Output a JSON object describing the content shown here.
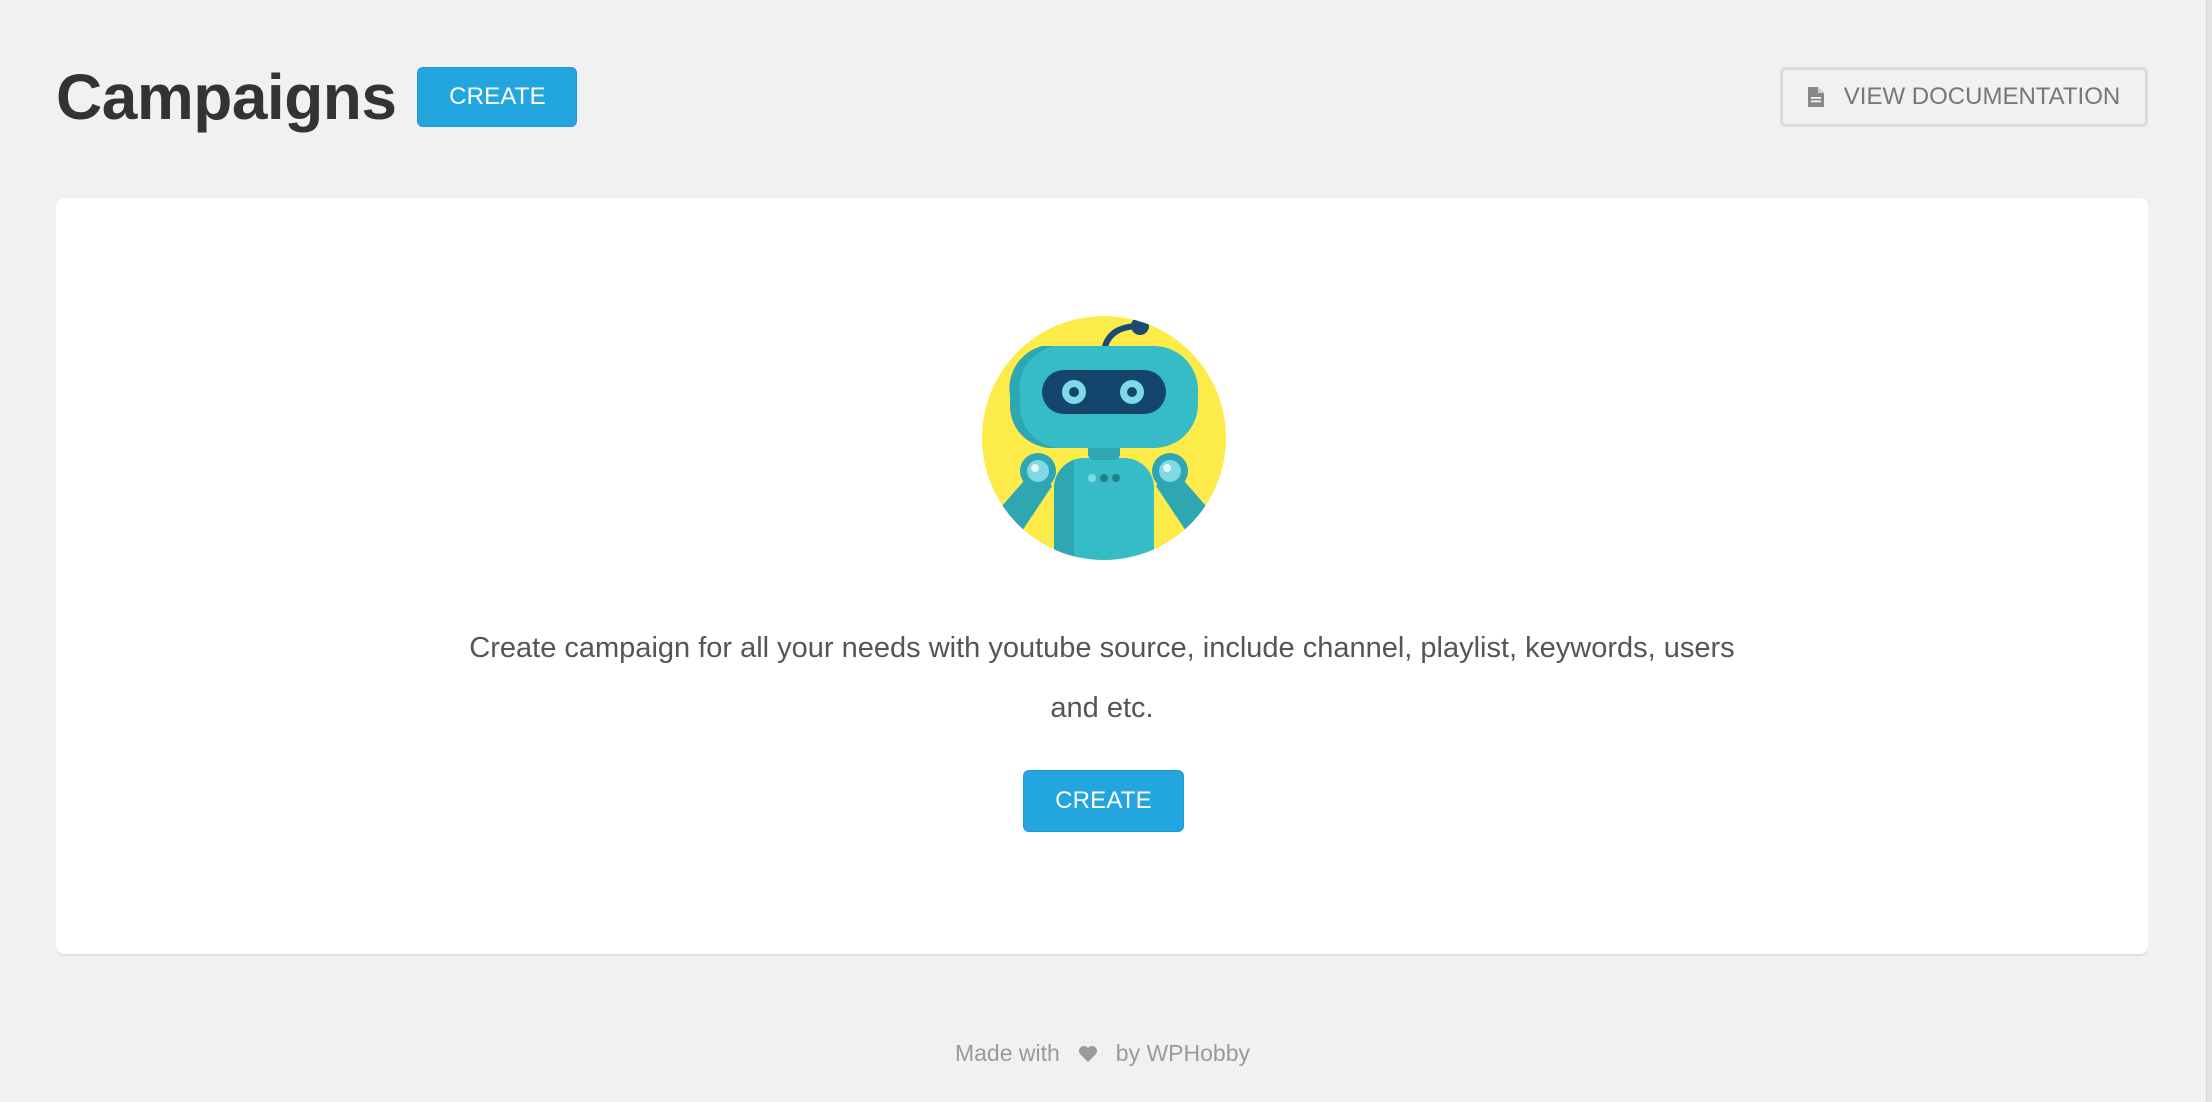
{
  "header": {
    "title": "Campaigns",
    "create_label": "CREATE",
    "docs_label": "VIEW DOCUMENTATION",
    "docs_icon": "document-icon"
  },
  "empty_state": {
    "illustration": "robot-icon",
    "description": "Create campaign for all your needs with youtube source, include channel, playlist, keywords, users and etc.",
    "create_label": "CREATE"
  },
  "footer": {
    "made_with": "Made with",
    "heart_icon": "heart-icon",
    "by": "by WPHobby"
  },
  "colors": {
    "primary": "#23a6e0",
    "background": "#f1f1f1",
    "card": "#ffffff",
    "title": "#333333",
    "robot_bg": "#fdeb4a",
    "robot_body": "#36bcc6"
  }
}
